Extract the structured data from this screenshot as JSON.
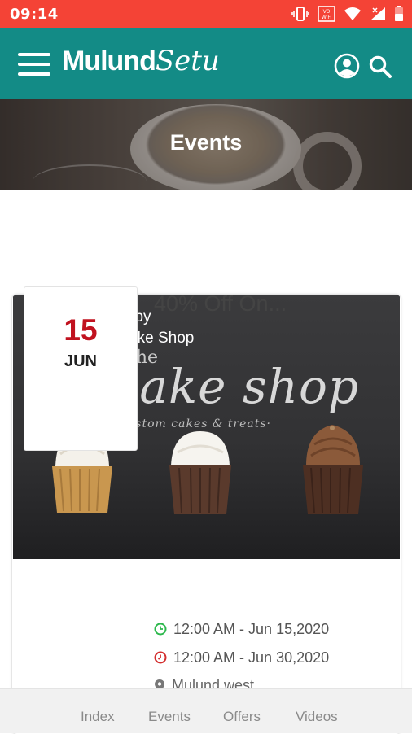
{
  "status_bar": {
    "time": "09:14",
    "icons": [
      "vibrate-icon",
      "volte-wifi-icon",
      "wifi-icon",
      "signal-icon",
      "battery-icon"
    ]
  },
  "app_bar": {
    "logo_part1": "Mulund",
    "logo_part2": "Setu",
    "icons": [
      "menu-icon",
      "user-icon",
      "search-icon"
    ]
  },
  "hero": {
    "title": "Events"
  },
  "event": {
    "hosted_label": "Hosted by",
    "host_name": "Sam Cake Shop",
    "image_text": {
      "the": "the",
      "brand": "Cake shop",
      "tagline": "·custom cakes & treats·"
    },
    "day": "15",
    "month": "JUN",
    "title": "40% Off On...",
    "start": "12:00 AM - Jun 15,2020",
    "end": "12:00 AM - Jun 30,2020",
    "location": "Mulund west"
  },
  "bottom_nav": {
    "items": [
      "Index",
      "Events",
      "Offers",
      "Videos"
    ]
  },
  "colors": {
    "status_bar": "#f44336",
    "app_bar": "#138b86",
    "date_red": "#c1121f",
    "start_icon": "#2db84d",
    "end_icon": "#d32f2f"
  }
}
